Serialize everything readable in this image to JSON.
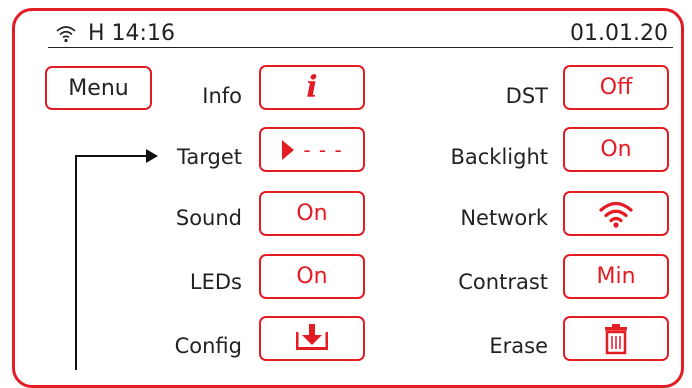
{
  "status_bar": {
    "wifi_icon": "wifi-icon",
    "clock": "H 14:16",
    "date": "01.01.20"
  },
  "menu": {
    "label": "Menu"
  },
  "settings_left": [
    {
      "label": "Info",
      "value": "",
      "icon": "info-icon"
    },
    {
      "label": "Target",
      "value": "",
      "icon": "target-direction-icon",
      "dashes": "- - -"
    },
    {
      "label": "Sound",
      "value": "On"
    },
    {
      "label": "LEDs",
      "value": "On"
    },
    {
      "label": "Config",
      "value": "",
      "icon": "download-tray-icon"
    }
  ],
  "settings_right": [
    {
      "label": "DST",
      "value": "Off"
    },
    {
      "label": "Backlight",
      "value": "On"
    },
    {
      "label": "Network",
      "value": "",
      "icon": "wifi-icon"
    },
    {
      "label": "Contrast",
      "value": "Min"
    },
    {
      "label": "Erase",
      "value": "",
      "icon": "trash-icon"
    }
  ],
  "colors": {
    "accent": "#e31b23",
    "text": "#222222"
  }
}
